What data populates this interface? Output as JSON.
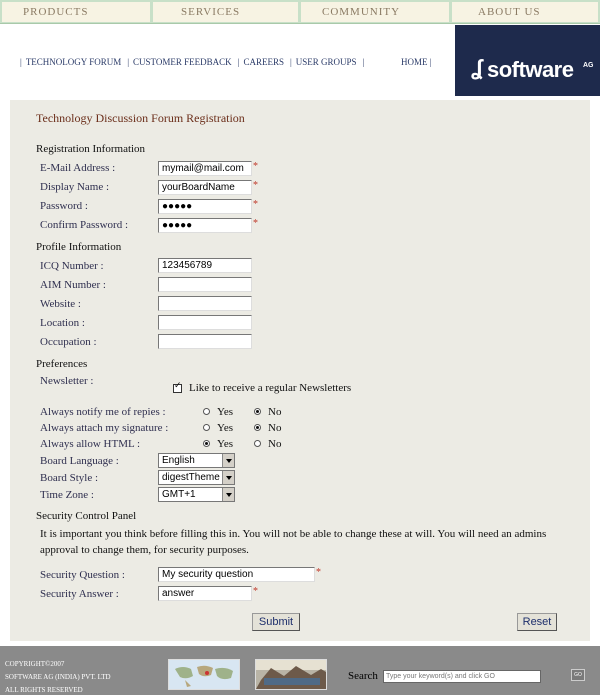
{
  "topnav": {
    "products": "PRODUCTS",
    "services": "SERVICES",
    "community": "COMMUNITY",
    "about": "ABOUT US"
  },
  "subnav": {
    "items": [
      "TECHNOLOGY FORUM",
      "CUSTOMER FEEDBACK",
      "CAREERS",
      "USER GROUPS"
    ],
    "home": "HOME"
  },
  "logo": {
    "mark": "ʆ",
    "word": "software",
    "ag": "AG"
  },
  "form": {
    "title": "Technology Discussion Forum Registration",
    "registration": {
      "heading": "Registration Information",
      "email_label": "E-Mail Address :",
      "email_value": "mymail@mail.com",
      "display_label": "Display Name :",
      "display_value": "yourBoardName",
      "password_label": "Password :",
      "password_value": "●●●●●",
      "confirm_label": "Confirm Password :",
      "confirm_value": "●●●●●",
      "required_mark": "*"
    },
    "profile": {
      "heading": "Profile Information",
      "icq_label": "ICQ Number :",
      "icq_value": "123456789",
      "aim_label": "AIM Number :",
      "aim_value": "",
      "website_label": "Website :",
      "website_value": "",
      "location_label": "Location :",
      "location_value": "",
      "occupation_label": "Occupation :",
      "occupation_value": ""
    },
    "preferences": {
      "heading": "Preferences",
      "newsletter_label": "Newsletter :",
      "newsletter_text": "Like to receive a regular Newsletters",
      "notify_label": "Always notify me of repies :",
      "attach_label": "Always attach my signature :",
      "html_label": "Always allow HTML :",
      "yes": "Yes",
      "no": "No",
      "language_label": "Board Language :",
      "language_value": "English",
      "style_label": "Board Style :",
      "style_value": "digestTheme",
      "timezone_label": "Time Zone :",
      "timezone_value": "GMT+1"
    },
    "security": {
      "heading": "Security Control Panel",
      "note": "It is important you think before filling this in. You will not be able to change these at will. You will need an admins approval to change them, for security purposes.",
      "question_label": "Security Question :",
      "question_value": "My security question",
      "answer_label": "Security Answer :",
      "answer_value": "answer"
    },
    "submit": "Submit",
    "reset": "Reset"
  },
  "footer": {
    "copy1": "COPYRIGHT©2007",
    "copy2": "SOFTWARE AG (INDIA) PVT. LTD",
    "copy3": "ALL RIGHTS RESERVED",
    "search_label": "Search",
    "search_placeholder": "Type your keyword(s) and click GO",
    "go": "GO"
  }
}
